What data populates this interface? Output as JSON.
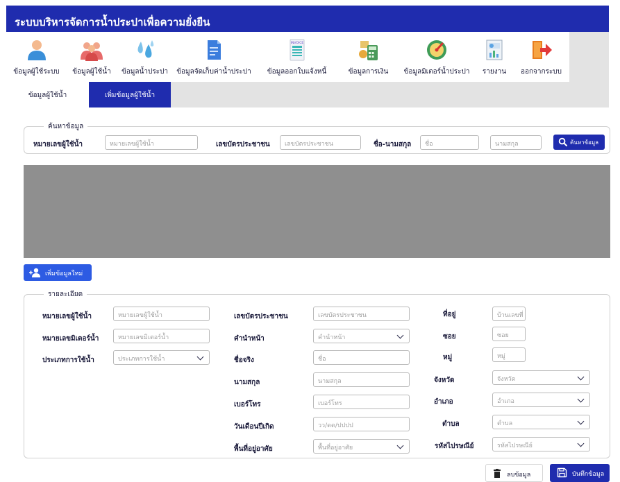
{
  "app_title": "ระบบบริหารจัดการน้ำประปาเพื่อความยั่งยืน",
  "menu": [
    {
      "label": "ข้อมูลผู้ใช้ระบบ",
      "icon": "user-icon"
    },
    {
      "label": "ข้อมูลผู้ใช้น้ำ",
      "icon": "users-icon"
    },
    {
      "label": "ข้อมูลน้ำประปา",
      "icon": "water-drops-icon"
    },
    {
      "label": "ข้อมูลจัดเก็บค่าน้ำประปา",
      "icon": "document-icon"
    },
    {
      "label": "ข้อมูลออกใบแจ้งหนี้",
      "icon": "invoice-icon"
    },
    {
      "label": "ข้อมูลการเงิน",
      "icon": "finance-calculator-icon"
    },
    {
      "label": "ข้อมูลมิเตอร์น้ำประปา",
      "icon": "gauge-icon"
    },
    {
      "label": "รายงาน",
      "icon": "report-icon"
    },
    {
      "label": "ออกจากระบบ",
      "icon": "logout-icon"
    }
  ],
  "invoice_icon_text": "INVOICE",
  "tabs": [
    "ข้อมูลผู้ใช้น้ำ",
    "เพิ่มข้อมูลผู้ใช้น้ำ"
  ],
  "search": {
    "legend": "ค้นหาข้อมูล",
    "water_user_no_label": "หมายเลขผู้ใช้น้ำ",
    "water_user_no_placeholder": "หมายเลขผู้ใช้น้ำ",
    "id_card_label": "เลขบัตรประชาชน",
    "id_card_placeholder": "เลขบัตรประชาชน",
    "name_label": "ชื่อ-นามสกุล",
    "first_name_placeholder": "ชื่อ",
    "last_name_placeholder": "นามสกุล",
    "button": "ค้นหาข้อมูล"
  },
  "add_button": "เพิ่มข้อมูลใหม่",
  "detail": {
    "legend": "รายละเอียด",
    "water_user_no": {
      "label": "หมายเลขผู้ใช้น้ำ",
      "placeholder": "หมายเลขผู้ใช้น้ำ"
    },
    "meter_no": {
      "label": "หมายเลขมิเตอร์น้ำ",
      "placeholder": "หมายเลขมิเตอร์น้ำ"
    },
    "usage_type": {
      "label": "ประเภทการใช้น้ำ",
      "placeholder": "ประเภทการใช้น้ำ"
    },
    "id_card": {
      "label": "เลขบัตรประชาชน",
      "placeholder": "เลขบัตรประชาชน"
    },
    "prefix": {
      "label": "คำนำหน้า",
      "placeholder": "คำนำหน้า"
    },
    "first_name": {
      "label": "ชื่อจริง",
      "placeholder": "ชื่อ"
    },
    "last_name": {
      "label": "นามสกุล",
      "placeholder": "นามสกุล"
    },
    "phone": {
      "label": "เบอร์โทร",
      "placeholder": "เบอร์โทร"
    },
    "birth_date": {
      "label": "วันเดือนปีเกิด",
      "placeholder": "วว/ดด/ปปปป"
    },
    "residence_area": {
      "label": "พื้นที่อยู่อาศัย",
      "placeholder": "พื้นที่อยู่อาศัย"
    },
    "address": {
      "label": "ที่อยู่",
      "placeholder": "บ้านเลขที่"
    },
    "soi": {
      "label": "ซอย",
      "placeholder": "ซอย"
    },
    "moo": {
      "label": "หมู่",
      "placeholder": "หมู่"
    },
    "province": {
      "label": "จังหวัด",
      "placeholder": "จังหวัด"
    },
    "district": {
      "label": "อำเภอ",
      "placeholder": "อำเภอ"
    },
    "subdistrict": {
      "label": "ตำบล",
      "placeholder": "ตำบล"
    },
    "postal_code": {
      "label": "รหัสไปรษณีย์",
      "placeholder": "รหัสไปรษณีย์"
    }
  },
  "delete_button": "ลบข้อมูล",
  "save_button": "บันทึกข้อมูล",
  "colors": {
    "primary": "#1f2cae",
    "add_button": "#2d5be3",
    "gray_panel": "#8f8f8f"
  }
}
